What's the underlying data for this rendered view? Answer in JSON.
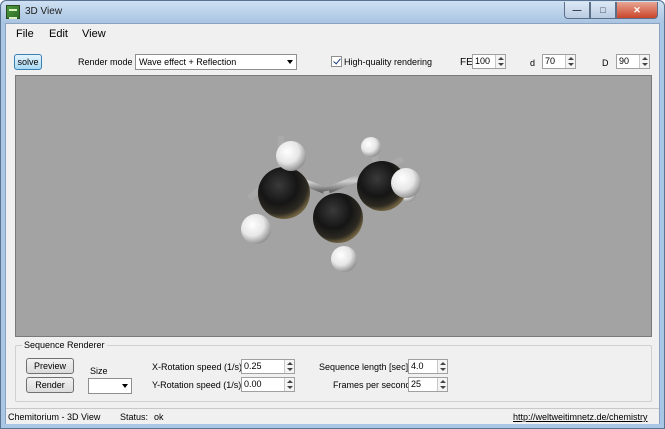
{
  "window": {
    "title": "3D View"
  },
  "menu": {
    "items": [
      "File",
      "Edit",
      "View"
    ]
  },
  "toolbar": {
    "solve_label": "solve",
    "render_mode_label": "Render mode",
    "render_mode_value": "Wave effect + Reflection",
    "hq_label": "High-quality rendering",
    "hq_checked": true,
    "fe_label": "FE",
    "fe_value": "100",
    "d_small_label": "d",
    "d_small_value": "70",
    "d_big_label": "D",
    "d_big_value": "90"
  },
  "viewport": {
    "background": "#a3a3a3",
    "atom_colors": {
      "carbon": "#1e1e1e",
      "hydrogen": "#f2f2f2"
    }
  },
  "sequence": {
    "group_title": "Sequence Renderer",
    "preview_label": "Preview",
    "render_label": "Render",
    "size_label": "Size",
    "size_value": "",
    "x_rot_label": "X-Rotation speed (1/s)",
    "x_rot_value": "0.25",
    "y_rot_label": "Y-Rotation speed (1/s)",
    "y_rot_value": "0.00",
    "seq_len_label": "Sequence length [sec]",
    "seq_len_value": "4.0",
    "fps_label": "Frames per second",
    "fps_value": "25"
  },
  "status": {
    "app_name": "Chemitorium - 3D View",
    "status_label": "Status:",
    "status_value": "ok",
    "link": "http://weltweitimnetz.de/chemistry"
  }
}
